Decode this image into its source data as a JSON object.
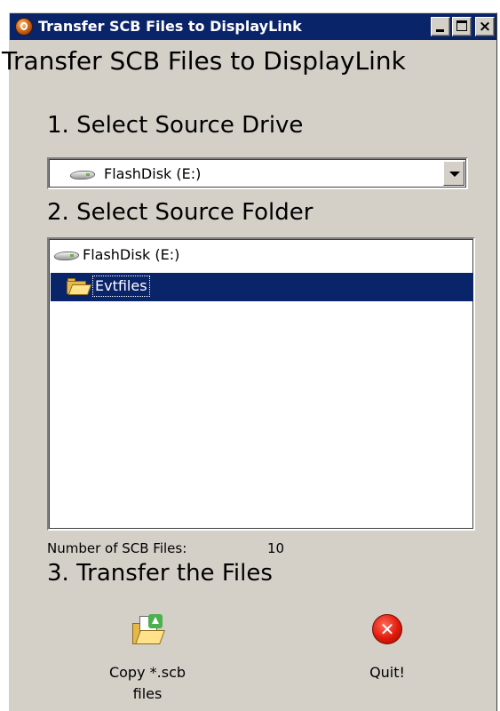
{
  "window": {
    "title": "Transfer SCB Files to DisplayLink",
    "controls": {
      "minimize": "minimize",
      "maximize": "maximize",
      "close": "×"
    }
  },
  "heading": "Transfer SCB Files to DisplayLink",
  "step1": {
    "label": "1. Select Source Drive",
    "drive_select": {
      "value": "FlashDisk (E:)",
      "icon": "drive-icon"
    }
  },
  "step2": {
    "label": "2. Select Source Folder",
    "tree": {
      "root": {
        "label": "FlashDisk (E:)",
        "icon": "drive-icon"
      },
      "children": [
        {
          "label": "Evtfiles",
          "icon": "folder-icon",
          "selected": true
        }
      ]
    }
  },
  "file_count": {
    "label": "Number of SCB Files:",
    "value": "10"
  },
  "step3": {
    "label": "3. Transfer the Files",
    "copy_button": {
      "label": "Copy *.scb\nfiles",
      "icon": "copy-files-icon"
    },
    "quit_button": {
      "label": "Quit!",
      "icon": "quit-icon"
    }
  },
  "colors": {
    "titlebar": "#0a246a",
    "face": "#d4d0c8",
    "selection": "#0a246a"
  }
}
